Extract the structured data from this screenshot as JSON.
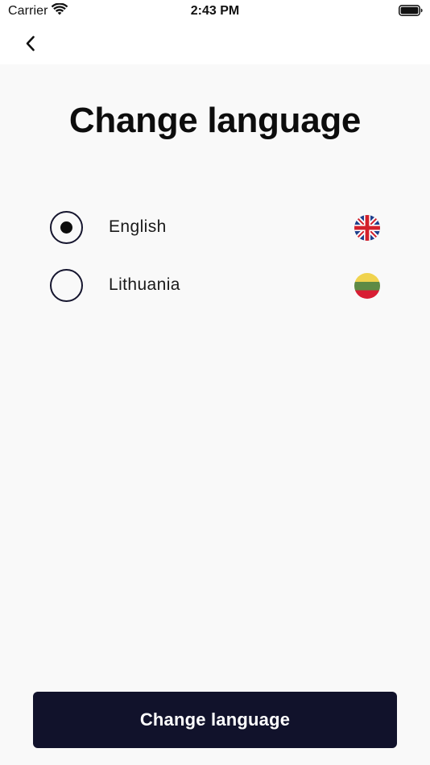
{
  "status_bar": {
    "carrier": "Carrier",
    "time": "2:43 PM"
  },
  "nav": {
    "back_icon": "chevron-left-icon"
  },
  "page": {
    "title": "Change language"
  },
  "languages": [
    {
      "label": "English",
      "selected": true,
      "flag_icon": "uk-flag-icon"
    },
    {
      "label": "Lithuania",
      "selected": false,
      "flag_icon": "lithuania-flag-icon"
    }
  ],
  "footer": {
    "button_label": "Change language"
  },
  "colors": {
    "primary": "#11122b",
    "background": "#f9f9f9",
    "radio_border": "#15152e"
  }
}
